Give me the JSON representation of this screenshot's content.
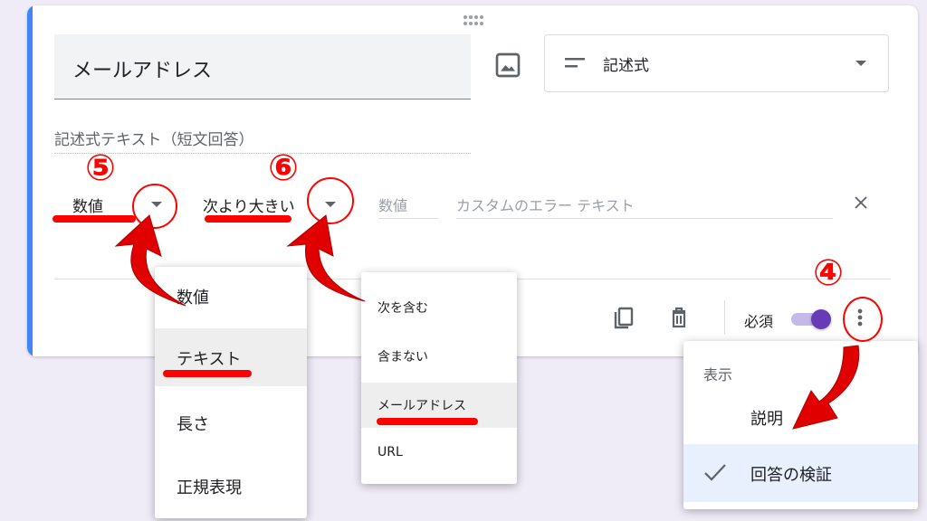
{
  "question": {
    "title": "メールアドレス",
    "type_label": "記述式",
    "answer_hint": "記述式テキスト（短文回答）"
  },
  "validation": {
    "type_value": "数値",
    "condition_value": "次より大きい",
    "number_placeholder": "数値",
    "error_placeholder": "カスタムのエラー テキスト"
  },
  "footer": {
    "required_label": "必須",
    "required_on": true
  },
  "menu_validation_type": {
    "items": [
      "数値",
      "テキスト",
      "長さ",
      "正規表現"
    ],
    "selected": "テキスト"
  },
  "menu_text_condition": {
    "items": [
      "次を含む",
      "含まない",
      "メールアドレス",
      "URL"
    ],
    "selected": "メールアドレス"
  },
  "menu_more": {
    "header": "表示",
    "items": [
      "説明",
      "回答の検証"
    ],
    "checked": "回答の検証"
  },
  "annotations": {
    "step4": "④",
    "step5": "⑤",
    "step6": "⑥"
  },
  "colors": {
    "accent": "#4285f4",
    "toggle": "#673ab7",
    "annotation": "#ff0000",
    "background": "#efebf7"
  }
}
